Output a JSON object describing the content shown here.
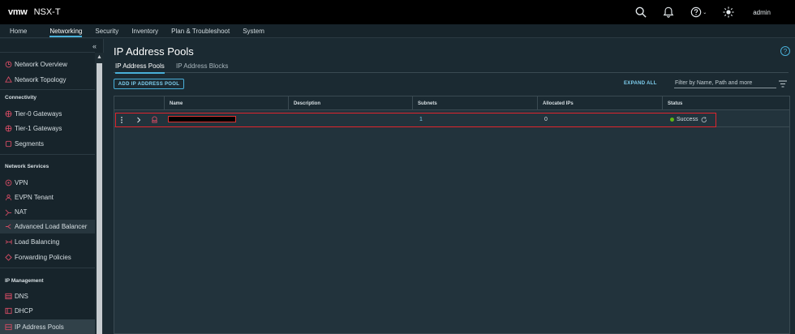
{
  "header": {
    "logo": "vmw",
    "product": "NSX-T",
    "user": "admin"
  },
  "topnav": {
    "tabs": [
      "Home",
      "Networking",
      "Security",
      "Inventory",
      "Plan & Troubleshoot",
      "System"
    ]
  },
  "sidebar": {
    "collapse": "«",
    "items_top": [
      "Network Overview",
      "Network Topology"
    ],
    "section_connectivity": "Connectivity",
    "items_connectivity": [
      "Tier-0 Gateways",
      "Tier-1 Gateways",
      "Segments"
    ],
    "section_network_services": "Network Services",
    "items_services": [
      "VPN",
      "EVPN Tenant",
      "NAT",
      "Advanced Load Balancer",
      "Load Balancing",
      "Forwarding Policies"
    ],
    "section_ip_management": "IP Management",
    "items_ip": [
      "DNS",
      "DHCP",
      "IP Address Pools"
    ]
  },
  "main": {
    "title": "IP Address Pools",
    "help": "?",
    "subtabs": [
      "IP Address Pools",
      "IP Address Blocks"
    ],
    "add_button": "ADD IP ADDRESS POOL",
    "expand_all": "EXPAND ALL",
    "filter_placeholder": "Filter by Name, Path and more"
  },
  "table": {
    "columns": [
      "Name",
      "Description",
      "Subnets",
      "Allocated IPs",
      "Status"
    ],
    "rows": [
      {
        "name": "",
        "description": "",
        "subnets": "1",
        "allocated_ips": "0",
        "status": "Success"
      }
    ]
  },
  "colors": {
    "accent": "#49afd9",
    "highlight": "#e0252d",
    "success": "#60b515"
  }
}
